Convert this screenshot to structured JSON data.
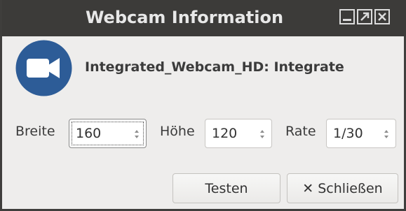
{
  "window": {
    "title": "Webcam Information"
  },
  "icons": {
    "camera": "video-camera-icon",
    "minimize": "minimize-icon",
    "maximize": "maximize-icon",
    "close": "close-icon",
    "button_close": "x-icon"
  },
  "colors": {
    "titlebar": "#3c3b39",
    "camera_circle": "#2d5c97",
    "background": "#eeedec"
  },
  "device": {
    "name": "Integrated_Webcam_HD: Integrate"
  },
  "settings": {
    "width_label": "Breite",
    "width_value": "160",
    "height_label": "Höhe",
    "height_value": "120",
    "rate_label": "Rate",
    "rate_value": "1/30"
  },
  "buttons": {
    "test_label": "Testen",
    "close_glyph": "✕",
    "close_label": "Schließen"
  }
}
